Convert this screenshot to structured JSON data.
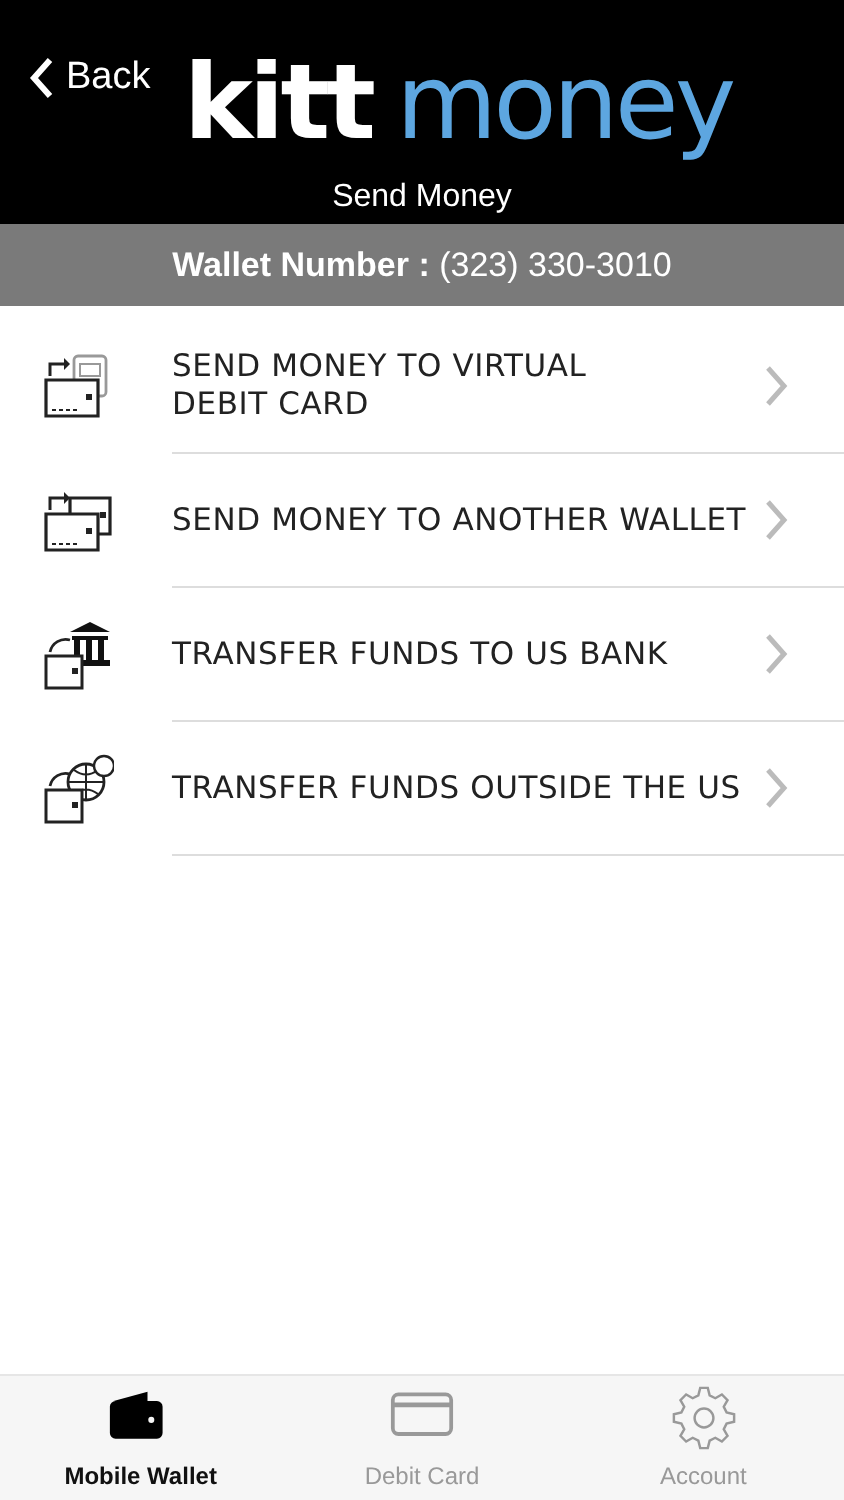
{
  "header": {
    "back": "Back",
    "logo": {
      "first": "kitt",
      "second": "money"
    },
    "title": "Send Money"
  },
  "wallet_bar": "**Wallet Number :** (323) 330-3010",
  "options": [
    {
      "kind": "virtual-card",
      "label": "SEND MONEY TO VIRTUAL\nDEBIT CARD"
    },
    {
      "kind": "wallet",
      "label": "SEND MONEY TO ANOTHER WALLET"
    },
    {
      "kind": "bank",
      "label": "TRANSFER FUNDS TO US BANK"
    },
    {
      "kind": "globe",
      "label": "TRANSFER FUNDS OUTSIDE THE US"
    }
  ],
  "tabs": [
    {
      "kind": "wallet",
      "label": "Mobile Wallet",
      "selected": true
    },
    {
      "kind": "card",
      "label": "Debit Card",
      "selected": false
    },
    {
      "kind": "gear",
      "label": "Account",
      "selected": false
    }
  ]
}
